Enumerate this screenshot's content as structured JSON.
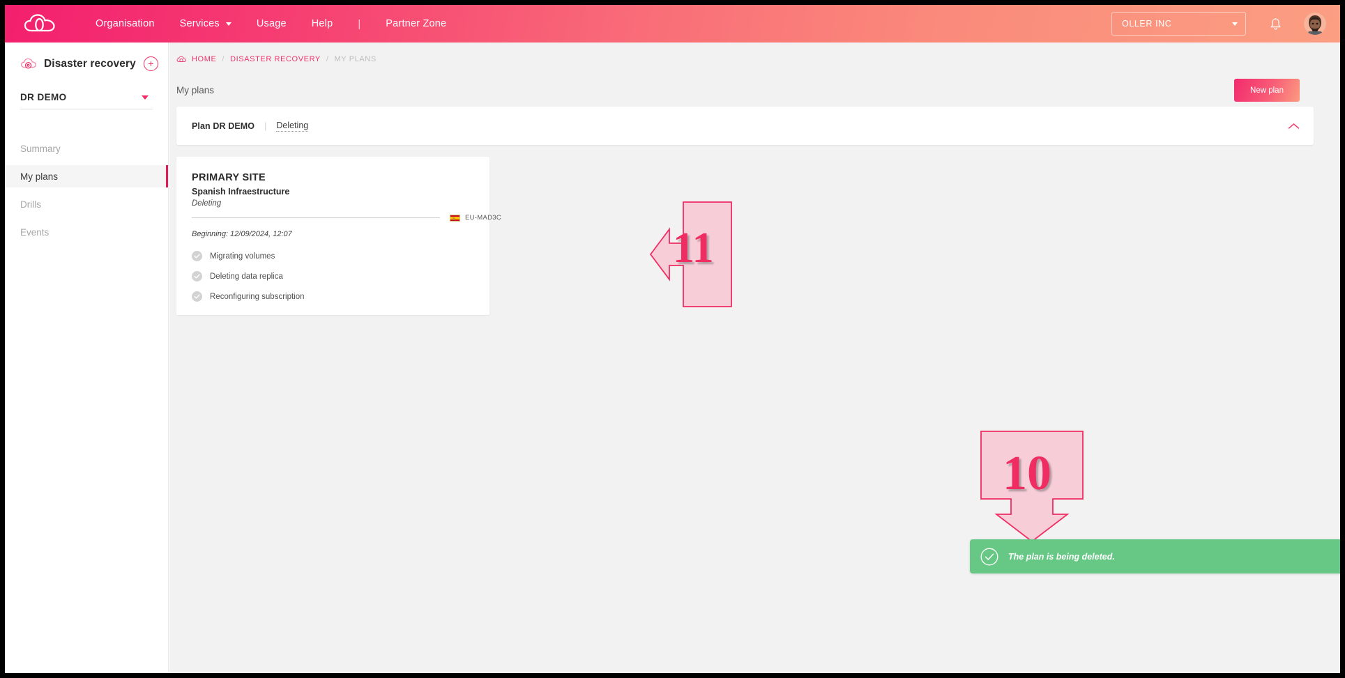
{
  "colors": {
    "brand_pink": "#ef2d63",
    "brand_pink_deep": "#f31f6e",
    "brand_salmon": "#fb9e82",
    "toast_green": "#67c784",
    "active_border": "#e01b56"
  },
  "topbar": {
    "logo_icon": "cloud-logo-icon",
    "nav": [
      {
        "label": "Organisation",
        "caret": false
      },
      {
        "label": "Services",
        "caret": true
      },
      {
        "label": "Usage",
        "caret": false
      },
      {
        "label": "Help",
        "caret": false
      }
    ],
    "separator": "|",
    "partner_zone_label": "Partner Zone",
    "org_selector": {
      "value": "OLLER INC",
      "icon": "chevron-down-icon"
    },
    "bell_icon": "notification-bell-icon",
    "avatar_icon": "user-avatar"
  },
  "sidebar": {
    "section_icon": "disaster-recovery-cloud-icon",
    "section_title": "Disaster recovery",
    "add_button_label": "+",
    "project": {
      "name": "DR DEMO",
      "caret_icon": "chevron-down-icon"
    },
    "items": [
      {
        "label": "Summary",
        "active": false
      },
      {
        "label": "My plans",
        "active": true
      },
      {
        "label": "Drills",
        "active": false
      },
      {
        "label": "Events",
        "active": false
      }
    ]
  },
  "main": {
    "breadcrumb": {
      "icon": "cloud-icon",
      "items": [
        "HOME",
        "DISASTER RECOVERY",
        "MY PLANS"
      ],
      "separator": "/"
    },
    "page_title": "My plans",
    "new_plan_button": "New plan",
    "plan_panel": {
      "name": "Plan DR DEMO",
      "divider": "|",
      "status": "Deleting",
      "collapse_icon": "chevron-up-icon"
    },
    "site_card": {
      "kind": "PRIMARY SITE",
      "name": "Spanish Infraestructure",
      "state": "Deleting",
      "region": {
        "flag": "flag-spain-icon",
        "label": "EU-MAD3C"
      },
      "beginning": "Beginning: 12/09/2024, 12:07",
      "steps": [
        {
          "icon": "check-circle-icon",
          "label": "Migrating volumes"
        },
        {
          "icon": "check-circle-icon",
          "label": "Deleting data replica"
        },
        {
          "icon": "check-circle-icon",
          "label": "Reconfiguring subscription"
        }
      ]
    }
  },
  "annotations": [
    {
      "number": "11",
      "direction": "left",
      "icon": "callout-arrow-left"
    },
    {
      "number": "10",
      "direction": "down",
      "icon": "callout-arrow-down"
    }
  ],
  "toast": {
    "icon": "success-check-circle-icon",
    "message": "The plan is being deleted.",
    "close_icon": "close-icon"
  }
}
